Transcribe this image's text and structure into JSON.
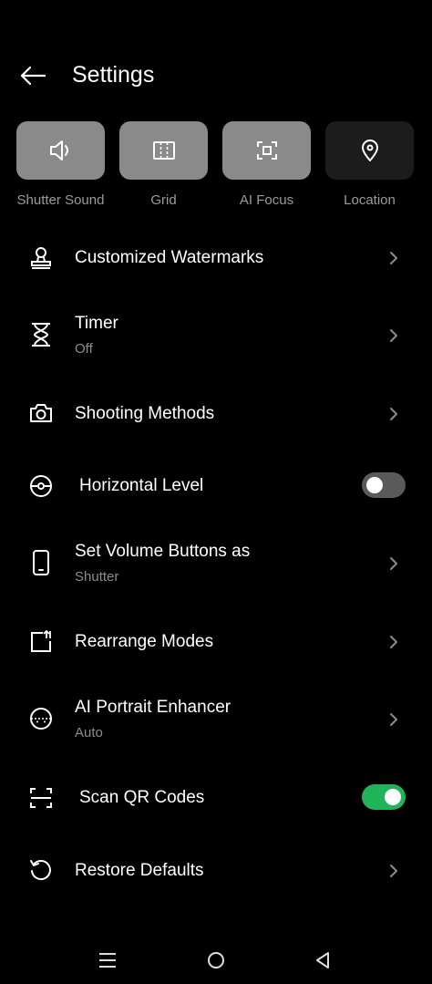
{
  "header": {
    "title": "Settings"
  },
  "quick_toggles": [
    {
      "label": "Shutter Sound",
      "icon": "speaker-icon",
      "active": true
    },
    {
      "label": "Grid",
      "icon": "grid-icon",
      "active": true
    },
    {
      "label": "AI Focus",
      "icon": "focus-icon",
      "active": true
    },
    {
      "label": "Location",
      "icon": "location-pin-icon",
      "active": false
    }
  ],
  "settings": [
    {
      "title": "Customized Watermarks",
      "icon": "stamp-icon",
      "control": "chevron"
    },
    {
      "title": "Timer",
      "subtitle": "Off",
      "icon": "hourglass-icon",
      "control": "chevron"
    },
    {
      "title": "Shooting Methods",
      "icon": "camera-icon",
      "control": "chevron"
    },
    {
      "title": "Horizontal Level",
      "icon": "level-icon",
      "control": "toggle",
      "enabled": false
    },
    {
      "title": "Set Volume Buttons as",
      "subtitle": "Shutter",
      "icon": "phone-icon",
      "control": "chevron"
    },
    {
      "title": "Rearrange Modes",
      "icon": "rearrange-icon",
      "control": "chevron"
    },
    {
      "title": "AI Portrait Enhancer",
      "subtitle": "Auto",
      "icon": "face-icon",
      "control": "chevron"
    },
    {
      "title": "Scan QR Codes",
      "icon": "scan-icon",
      "control": "toggle",
      "enabled": true
    },
    {
      "title": "Restore Defaults",
      "icon": "restore-icon",
      "control": "chevron"
    }
  ],
  "colors": {
    "tile_on": "#8a8a8a",
    "tile_off": "#1c1c1c",
    "toggle_on": "#21b25a",
    "toggle_off": "#5a5a5a"
  }
}
